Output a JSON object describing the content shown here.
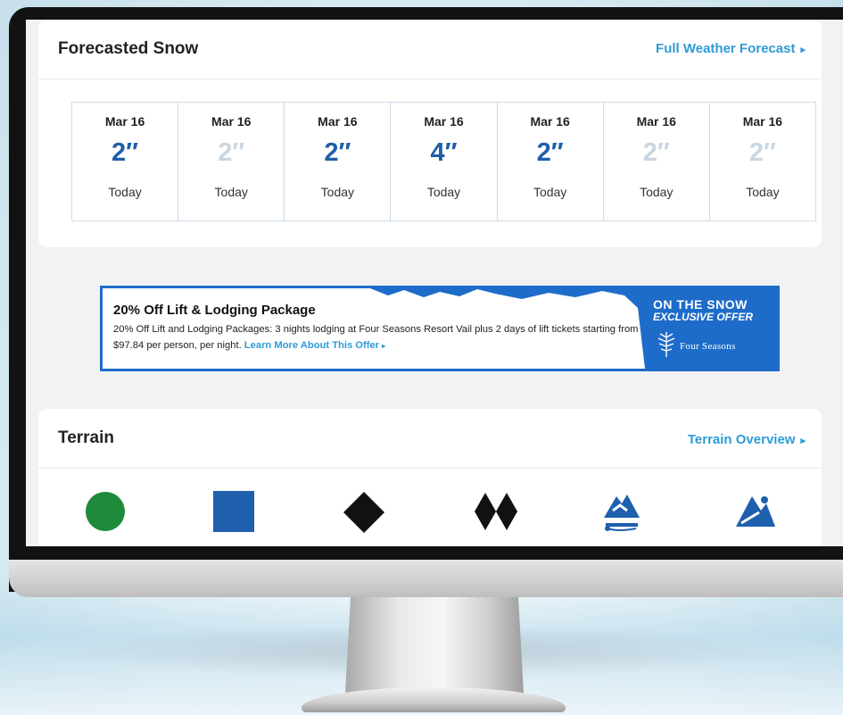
{
  "forecast": {
    "title": "Forecasted Snow",
    "link_label": "Full Weather Forecast",
    "link_icon": "chevron-right-icon",
    "days": [
      {
        "date": "Mar 16",
        "amount": "2″",
        "label": "Today",
        "highlight": true
      },
      {
        "date": "Mar 16",
        "amount": "2″",
        "label": "Today",
        "highlight": false
      },
      {
        "date": "Mar 16",
        "amount": "2″",
        "label": "Today",
        "highlight": true
      },
      {
        "date": "Mar 16",
        "amount": "4″",
        "label": "Today",
        "highlight": true
      },
      {
        "date": "Mar 16",
        "amount": "2″",
        "label": "Today",
        "highlight": true
      },
      {
        "date": "Mar 16",
        "amount": "2″",
        "label": "Today",
        "highlight": false
      },
      {
        "date": "Mar 16",
        "amount": "2″",
        "label": "Today",
        "highlight": false
      }
    ]
  },
  "ad": {
    "title": "20% Off Lift & Lodging Package",
    "body": "20% Off Lift and Lodging Packages: 3 nights lodging at Four Seasons Resort Vail plus 2 days of lift tickets starting from $97.84 per person, per night.",
    "link_label": "Learn More About This Offer",
    "brand_line1": "ON THE SNOW",
    "brand_line2": "EXCLUSIVE OFFER",
    "partner": "Four Seasons"
  },
  "terrain": {
    "title": "Terrain",
    "link_label": "Terrain Overview",
    "icons": [
      "green-circle-icon",
      "blue-square-icon",
      "black-diamond-icon",
      "double-black-diamond-icon",
      "terrain-park-icon",
      "backcountry-icon"
    ]
  },
  "colors": {
    "accent": "#2e9bd6",
    "snow_amount": "#1f5ea8",
    "snow_amount_muted": "#c9d6e2",
    "ad_blue": "#1e6cc9",
    "green_run": "#1f8b3a",
    "blue_run": "#1e5fae"
  }
}
